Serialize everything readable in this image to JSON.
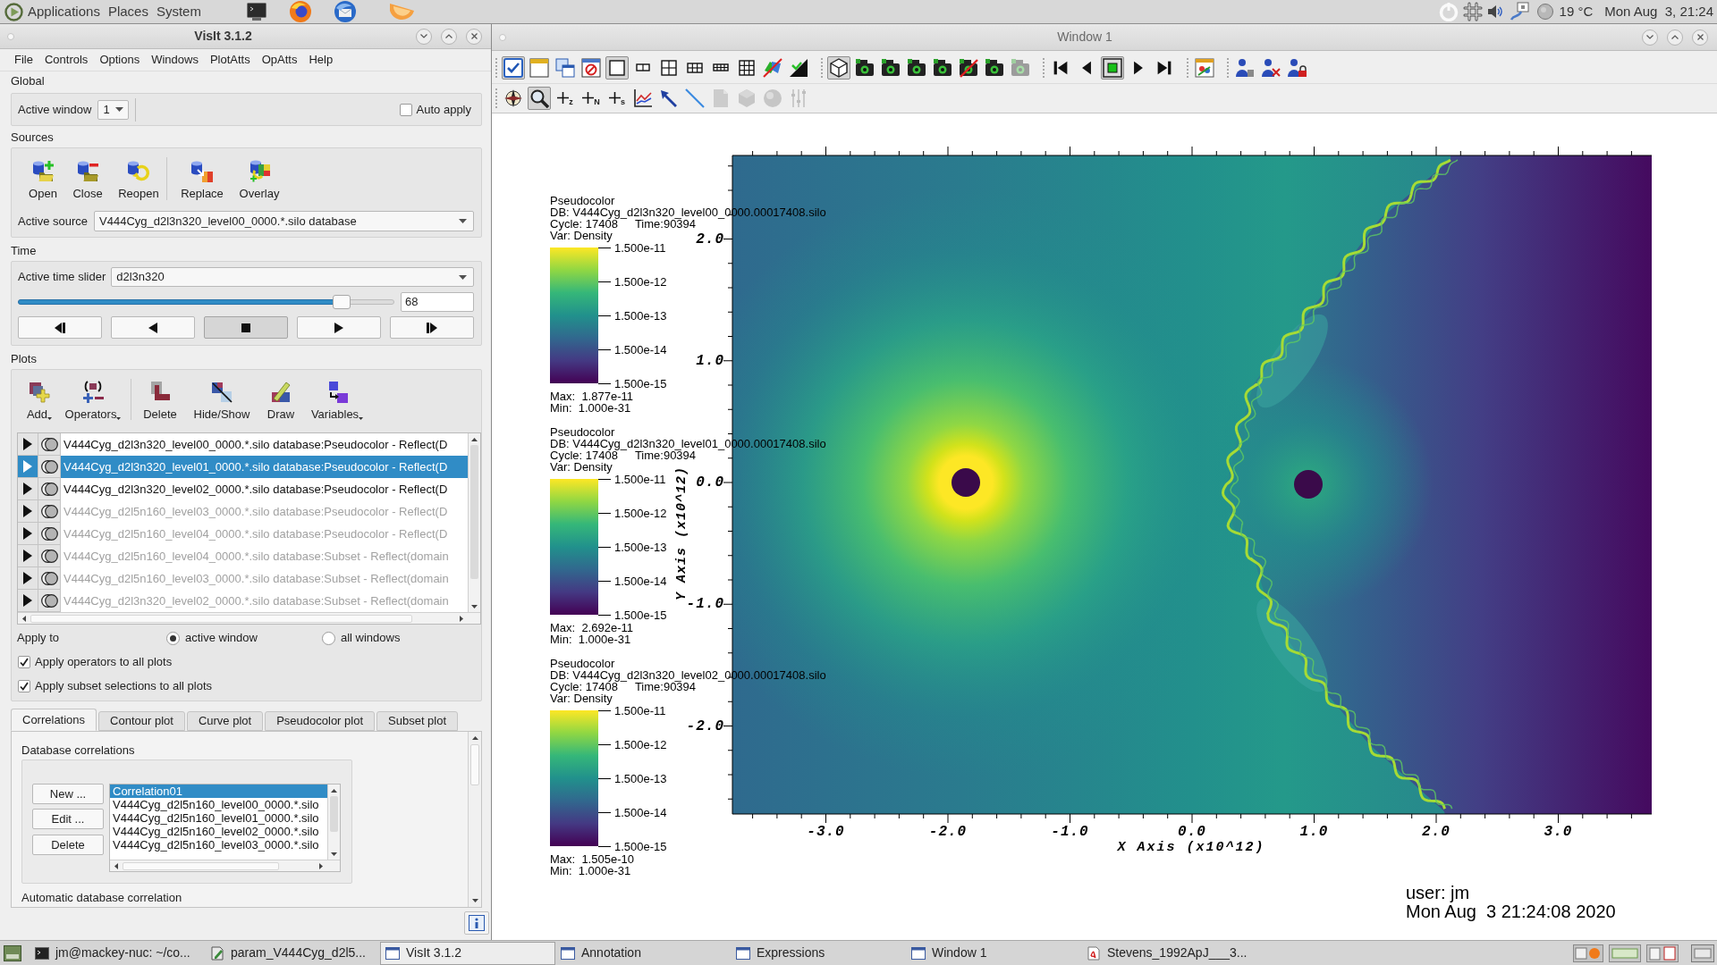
{
  "top_panel": {
    "menus": [
      "Applications",
      "Places",
      "System"
    ],
    "weather": "19 °C",
    "clock": "Mon Aug  3, 21:24"
  },
  "main_window": {
    "title": "VisIt 3.1.2",
    "menu": [
      "File",
      "Controls",
      "Options",
      "Windows",
      "PlotAtts",
      "OpAtts",
      "Help"
    ],
    "global": {
      "heading": "Global",
      "active_window_label": "Active window",
      "active_window": "1",
      "auto_apply": {
        "label": "Auto apply",
        "checked": false
      }
    },
    "sources": {
      "heading": "Sources",
      "tools": [
        "Open",
        "Close",
        "Reopen",
        "Replace",
        "Overlay"
      ],
      "active_source_label": "Active source",
      "active_source": "V444Cyg_d2l3n320_level00_0000.*.silo database"
    },
    "time": {
      "heading": "Time",
      "slider_label": "Active time slider",
      "slider_name": "d2l3n320",
      "level": 0.86,
      "state": "68",
      "controls": [
        {
          "kind": "step-back",
          "selected": false
        },
        {
          "kind": "reverse",
          "selected": false
        },
        {
          "kind": "stop",
          "selected": true
        },
        {
          "kind": "play",
          "selected": false
        },
        {
          "kind": "step-forward",
          "selected": false
        }
      ]
    },
    "plots": {
      "heading": "Plots",
      "tools": [
        {
          "label": "Add",
          "menu": true
        },
        {
          "label": "Operators",
          "menu": true
        },
        {
          "label": "Delete",
          "menu": false
        },
        {
          "label": "Hide/Show",
          "menu": false
        },
        {
          "label": "Draw",
          "menu": false
        },
        {
          "label": "Variables",
          "menu": true
        }
      ],
      "items": [
        {
          "label": "V444Cyg_d2l3n320_level00_0000.*.silo database:Pseudocolor - Reflect(D",
          "selected": false,
          "dimmed": false
        },
        {
          "label": "V444Cyg_d2l3n320_level01_0000.*.silo database:Pseudocolor - Reflect(D",
          "selected": true,
          "dimmed": false
        },
        {
          "label": "V444Cyg_d2l3n320_level02_0000.*.silo database:Pseudocolor - Reflect(D",
          "selected": false,
          "dimmed": false
        },
        {
          "label": "V444Cyg_d2l5n160_level03_0000.*.silo database:Pseudocolor - Reflect(D",
          "selected": false,
          "dimmed": true
        },
        {
          "label": "V444Cyg_d2l5n160_level04_0000.*.silo database:Pseudocolor - Reflect(D",
          "selected": false,
          "dimmed": true
        },
        {
          "label": "V444Cyg_d2l5n160_level04_0000.*.silo database:Subset - Reflect(domain",
          "selected": false,
          "dimmed": true
        },
        {
          "label": "V444Cyg_d2l5n160_level03_0000.*.silo database:Subset - Reflect(domain",
          "selected": false,
          "dimmed": true
        },
        {
          "label": "V444Cyg_d2l3n320_level02_0000.*.silo database:Subset - Reflect(domain",
          "selected": false,
          "dimmed": true
        }
      ],
      "apply_to_label": "Apply to",
      "apply_to": [
        {
          "label": "active window",
          "selected": true
        },
        {
          "label": "all windows",
          "selected": false
        }
      ],
      "options": [
        {
          "label": "Apply operators to all plots",
          "checked": true
        },
        {
          "label": "Apply subset selections to all plots",
          "checked": true
        }
      ]
    },
    "tabs": [
      {
        "label": "Correlations",
        "selected": true
      },
      {
        "label": "Contour plot",
        "selected": false
      },
      {
        "label": "Curve plot",
        "selected": false
      },
      {
        "label": "Pseudocolor plot",
        "selected": false
      },
      {
        "label": "Subset plot",
        "selected": false
      }
    ],
    "correlations": {
      "heading": "Database correlations",
      "buttons": [
        "New ...",
        "Edit ...",
        "Delete"
      ],
      "items": [
        {
          "label": "Correlation01",
          "selected": true
        },
        {
          "label": "V444Cyg_d2l5n160_level00_0000.*.silo",
          "selected": false
        },
        {
          "label": "V444Cyg_d2l5n160_level01_0000.*.silo",
          "selected": false
        },
        {
          "label": "V444Cyg_d2l5n160_level02_0000.*.silo",
          "selected": false
        },
        {
          "label": "V444Cyg_d2l5n160_level03_0000.*.silo",
          "selected": false
        }
      ],
      "footer": "Automatic database correlation"
    }
  },
  "viewer": {
    "title": "Window 1",
    "toolbar_rows": [
      [
        [
          {
            "kind": "active",
            "selected": true,
            "disabled": false
          },
          {
            "kind": "new-window",
            "selected": false,
            "disabled": false
          },
          {
            "kind": "clone-window",
            "selected": false,
            "disabled": false
          },
          {
            "kind": "delete-window",
            "selected": false,
            "disabled": false
          },
          {
            "kind": "layout-1x1",
            "selected": true,
            "disabled": false
          },
          {
            "kind": "layout-1x2",
            "selected": false,
            "disabled": false
          },
          {
            "kind": "layout-2x2",
            "selected": false,
            "disabled": false
          },
          {
            "kind": "layout-2x3",
            "selected": false,
            "disabled": false
          },
          {
            "kind": "layout-2x4",
            "selected": false,
            "disabled": false
          },
          {
            "kind": "layout-3x3",
            "selected": false,
            "disabled": false
          },
          {
            "kind": "lock-view",
            "selected": false,
            "disabled": false
          },
          {
            "kind": "lock-time",
            "selected": false,
            "disabled": false
          }
        ],
        [
          {
            "kind": "view-3d",
            "selected": true,
            "disabled": false
          },
          {
            "kind": "camera",
            "selected": false,
            "disabled": false
          },
          {
            "kind": "camera",
            "selected": false,
            "disabled": false
          },
          {
            "kind": "camera",
            "selected": false,
            "disabled": false
          },
          {
            "kind": "camera",
            "selected": false,
            "disabled": false
          },
          {
            "kind": "camera-off",
            "selected": false,
            "disabled": false
          },
          {
            "kind": "camera",
            "selected": false,
            "disabled": false
          },
          {
            "kind": "camera",
            "selected": false,
            "disabled": true
          }
        ],
        [
          {
            "kind": "step-back",
            "selected": false,
            "disabled": false
          },
          {
            "kind": "reverse",
            "selected": false,
            "disabled": false
          },
          {
            "kind": "stop",
            "selected": true,
            "disabled": false
          },
          {
            "kind": "play",
            "selected": false,
            "disabled": false
          },
          {
            "kind": "step-forward",
            "selected": false,
            "disabled": false
          }
        ],
        [
          {
            "kind": "annotation",
            "selected": false,
            "disabled": false
          }
        ],
        [
          {
            "kind": "person",
            "selected": false,
            "disabled": false
          },
          {
            "kind": "person-x",
            "selected": false,
            "disabled": false
          },
          {
            "kind": "person-lock",
            "selected": false,
            "disabled": false
          }
        ]
      ],
      [
        [
          {
            "kind": "navigate",
            "selected": false,
            "disabled": false
          },
          {
            "kind": "zoom",
            "selected": true,
            "disabled": false
          },
          {
            "kind": "pick",
            "label": "z",
            "selected": false,
            "disabled": false
          },
          {
            "kind": "pick",
            "label": "N",
            "selected": false,
            "disabled": false
          },
          {
            "kind": "pick",
            "label": "s",
            "selected": false,
            "disabled": false
          },
          {
            "kind": "lineout",
            "selected": false,
            "disabled": false
          },
          {
            "kind": "pointer",
            "selected": false,
            "disabled": false
          },
          {
            "kind": "line",
            "selected": false,
            "disabled": false
          },
          {
            "kind": "page",
            "selected": false,
            "disabled": true
          },
          {
            "kind": "cube",
            "selected": false,
            "disabled": true
          },
          {
            "kind": "sphere",
            "selected": false,
            "disabled": true
          },
          {
            "kind": "sliders",
            "selected": false,
            "disabled": true
          }
        ]
      ]
    ],
    "legends": [
      {
        "title": "Pseudocolor",
        "db": "DB: V444Cyg_d2l3n320_level00_0000.00017408.silo",
        "cycle": "Cycle: 17408",
        "time": "Time:90394",
        "var": "Var: Density",
        "ticks": [
          "1.500e-11",
          "1.500e-12",
          "1.500e-13",
          "1.500e-14",
          "1.500e-15"
        ],
        "max": "Max:  1.877e-11",
        "min": "Min:  1.000e-31"
      },
      {
        "title": "Pseudocolor",
        "db": "DB: V444Cyg_d2l3n320_level01_0000.00017408.silo",
        "cycle": "Cycle: 17408",
        "time": "Time:90394",
        "var": "Var: Density",
        "ticks": [
          "1.500e-11",
          "1.500e-12",
          "1.500e-13",
          "1.500e-14",
          "1.500e-15"
        ],
        "max": "Max:  2.692e-11",
        "min": "Min:  1.000e-31"
      },
      {
        "title": "Pseudocolor",
        "db": "DB: V444Cyg_d2l3n320_level02_0000.00017408.silo",
        "cycle": "Cycle: 17408",
        "time": "Time:90394",
        "var": "Var: Density",
        "ticks": [
          "1.500e-11",
          "1.500e-12",
          "1.500e-13",
          "1.500e-14",
          "1.500e-15"
        ],
        "max": "Max:  1.505e-10",
        "min": "Min:  1.000e-31"
      }
    ],
    "plot": {
      "y_ticks": [
        "2.0",
        "1.0",
        "0.0",
        "-1.0",
        "-2.0"
      ],
      "x_ticks": [
        "-3.0",
        "-2.0",
        "-1.0",
        "0.0",
        "1.0",
        "2.0",
        "3.0"
      ],
      "x_label": "X Axis (x10^12)",
      "y_label": "Y Axis (x10^12)"
    },
    "user": "user: jm",
    "timestamp": "Mon Aug  3 21:24:08 2020"
  },
  "taskbar": [
    {
      "label": "jm@mackey-nuc: ~/co...",
      "kind": "terminal",
      "selected": false
    },
    {
      "label": "param_V444Cyg_d2l5...",
      "kind": "script",
      "selected": false
    },
    {
      "label": "VisIt 3.1.2",
      "kind": "window",
      "selected": true
    },
    {
      "label": "Annotation",
      "kind": "window",
      "selected": false
    },
    {
      "label": "Expressions",
      "kind": "window",
      "selected": false
    },
    {
      "label": "Window 1",
      "kind": "window",
      "selected": false
    },
    {
      "label": "Stevens_1992ApJ___3...",
      "kind": "pdf",
      "selected": false
    }
  ]
}
